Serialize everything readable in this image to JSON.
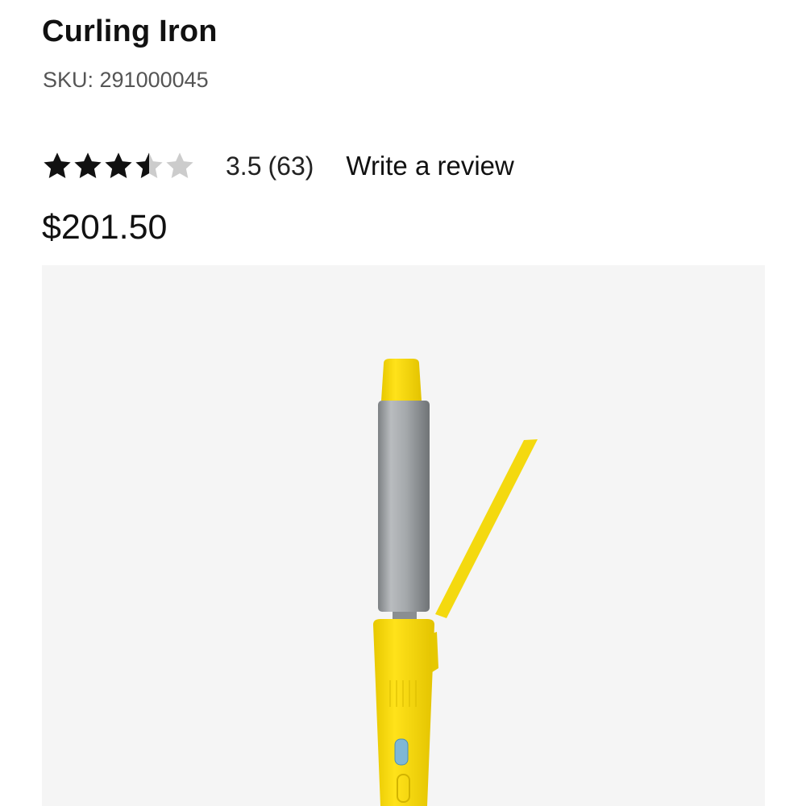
{
  "product": {
    "title": "Curling Iron",
    "sku_label": "SKU: 291000045",
    "rating": {
      "value": 3.5,
      "max": 5,
      "score_text": "3.5",
      "count_text": "(63)",
      "filled_color": "#111111",
      "empty_color": "#cccccc"
    },
    "review_link_label": "Write a review",
    "price": "$201.50"
  },
  "image": {
    "subject": "yellow curling iron with silver barrel",
    "background": "#f5f5f5",
    "accent_color": "#f5d90a",
    "barrel_color": "#a8acaf"
  }
}
